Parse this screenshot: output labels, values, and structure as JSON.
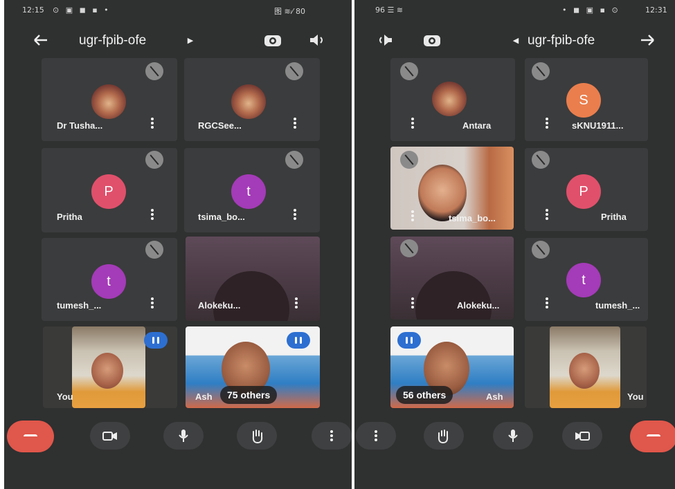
{
  "left_screen": {
    "status": {
      "time": "12:15",
      "right": "图 ≋ᵢ⁄ 80"
    },
    "header": {
      "back_icon": "arrow-left-icon",
      "meeting_code": "ugr-fpib-ofe",
      "expand_icon": "chevron-right-icon",
      "switch_camera_icon": "switch-camera-icon",
      "speaker_icon": "speaker-icon"
    },
    "tiles": [
      {
        "name": "Dr Tusha...",
        "type": "photo"
      },
      {
        "name": "RGCSee...",
        "type": "photo"
      },
      {
        "name": "Pritha",
        "initial": "P",
        "color": "#e0506b"
      },
      {
        "name": "tsima_bo...",
        "initial": "t",
        "color": "#a43bb8"
      },
      {
        "name": "tumesh_...",
        "initial": "t",
        "color": "#a43bb8"
      },
      {
        "name": "Alokeku...",
        "type": "video"
      },
      {
        "name": "You",
        "type": "video"
      },
      {
        "name": "Ash",
        "others": "75 others",
        "type": "video"
      }
    ],
    "controls": [
      "end-call-icon",
      "camera-icon",
      "mic-icon",
      "raise-hand-icon",
      "more-vert-icon"
    ]
  },
  "right_screen": {
    "status": {
      "time": "12:31",
      "left": "96 ☰ ≋"
    },
    "header": {
      "back_icon": "arrow-right-icon",
      "meeting_code": "ugr-fpib-ofe",
      "expand_icon": "chevron-left-icon",
      "switch_camera_icon": "switch-camera-icon",
      "speaker_icon": "speaker-icon"
    },
    "tiles": [
      {
        "name": "sKNU1911...",
        "initial": "S",
        "color": "#ea7e4d"
      },
      {
        "name": "Antara",
        "type": "photo"
      },
      {
        "name": "Pritha",
        "initial": "P",
        "color": "#e0506b"
      },
      {
        "name": "tsima_bo...",
        "type": "video"
      },
      {
        "name": "tumesh_...",
        "initial": "t",
        "color": "#a43bb8"
      },
      {
        "name": "Alokeku...",
        "type": "video"
      },
      {
        "name": "You",
        "type": "video"
      },
      {
        "name": "Ash",
        "others": "56 others",
        "type": "video"
      }
    ],
    "controls": [
      "more-vert-icon",
      "raise-hand-icon",
      "mic-icon",
      "camera-icon",
      "end-call-icon"
    ]
  },
  "colors": {
    "background": "#2f3030",
    "tile": "#3b3c3d",
    "end_call": "#e0574b",
    "speaking": "#2d6fd1"
  }
}
